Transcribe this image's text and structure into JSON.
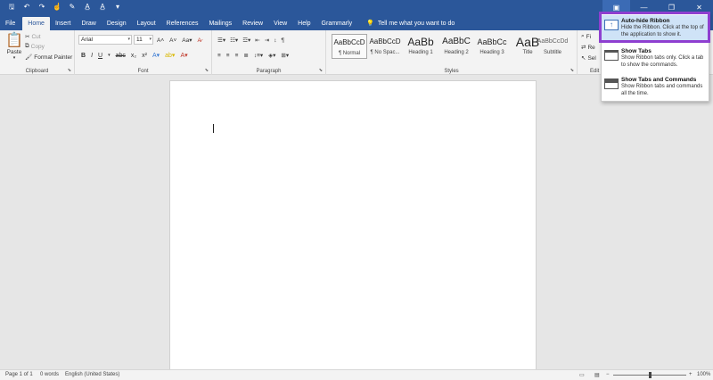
{
  "titlebar": {
    "qat_icons": [
      "save-icon",
      "undo-icon",
      "redo-icon",
      "touch-mode-icon",
      "format-painter-icon",
      "spelling-icon",
      "read-aloud-icon",
      "customize-qat-icon"
    ],
    "qat_glyphs": [
      "🖫",
      "↶",
      "↷",
      "☝",
      "✎",
      "A̲",
      "A̲",
      "▾"
    ]
  },
  "tabs": [
    "File",
    "Home",
    "Insert",
    "Draw",
    "Design",
    "Layout",
    "References",
    "Mailings",
    "Review",
    "View",
    "Help",
    "Grammarly"
  ],
  "tell_me": "Tell me what you want to do",
  "clipboard": {
    "paste": "Paste",
    "cut": "Cut",
    "copy": "Copy",
    "format_painter": "Format Painter",
    "label": "Clipboard"
  },
  "font": {
    "name": "Arial",
    "size": "11",
    "label": "Font",
    "buttons": [
      "B",
      "I",
      "U",
      "abc",
      "x₂",
      "x²"
    ]
  },
  "paragraph": {
    "label": "Paragraph"
  },
  "styles": {
    "label": "Styles",
    "items": [
      {
        "sample": "AaBbCcD",
        "name": "¶ Normal"
      },
      {
        "sample": "AaBbCcD",
        "name": "¶ No Spac..."
      },
      {
        "sample": "AaBb",
        "name": "Heading 1"
      },
      {
        "sample": "AaBbC",
        "name": "Heading 2"
      },
      {
        "sample": "AaBbCc",
        "name": "Heading 3"
      },
      {
        "sample": "AaB",
        "name": "Title"
      },
      {
        "sample": "AaBbCcDd",
        "name": "Subtitle"
      }
    ]
  },
  "editing": {
    "label": "Edit",
    "find": "Fi",
    "replace": "Re",
    "select": "Sel"
  },
  "ribbon_menu": {
    "items": [
      {
        "title": "Auto-hide Ribbon",
        "desc": "Hide the Ribbon. Click at the top of the application to show it."
      },
      {
        "title": "Show Tabs",
        "desc": "Show Ribbon tabs only. Click a tab to show the commands."
      },
      {
        "title": "Show Tabs and Commands",
        "desc": "Show Ribbon tabs and commands all the time."
      }
    ]
  },
  "statusbar": {
    "page": "Page 1 of 1",
    "words": "0 words",
    "language": "English (United States)",
    "zoom": "100%",
    "zoom_fraction": 0.5
  },
  "colors": {
    "accent": "#2b579a",
    "highlight_border": "#8e3fd0",
    "menu_hover": "#cfe3f7"
  }
}
